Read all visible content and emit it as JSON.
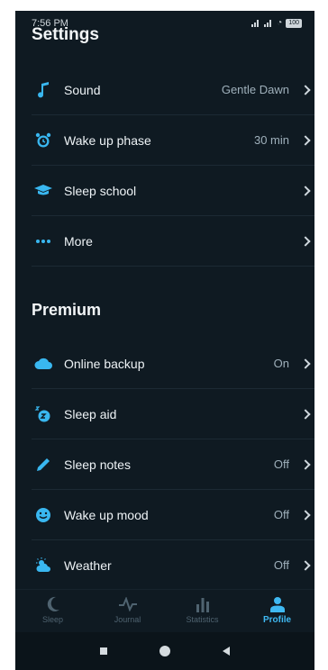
{
  "status_bar": {
    "time": "7:56 PM",
    "battery": "100"
  },
  "header": {
    "title": "Settings"
  },
  "settings": [
    {
      "icon": "music-note-icon",
      "label": "Sound",
      "value": "Gentle Dawn"
    },
    {
      "icon": "alarm-clock-icon",
      "label": "Wake up phase",
      "value": "30 min"
    },
    {
      "icon": "graduation-cap-icon",
      "label": "Sleep school",
      "value": ""
    },
    {
      "icon": "more-dots-icon",
      "label": "More",
      "value": ""
    }
  ],
  "premium": {
    "title": "Premium",
    "items": [
      {
        "icon": "cloud-icon",
        "label": "Online backup",
        "value": "On"
      },
      {
        "icon": "sleep-aid-icon",
        "label": "Sleep aid",
        "value": ""
      },
      {
        "icon": "pencil-icon",
        "label": "Sleep notes",
        "value": "Off"
      },
      {
        "icon": "smiley-icon",
        "label": "Wake up mood",
        "value": "Off"
      },
      {
        "icon": "weather-icon",
        "label": "Weather",
        "value": "Off"
      }
    ]
  },
  "bottom_nav": [
    {
      "icon": "moon-icon",
      "label": "Sleep",
      "active": false
    },
    {
      "icon": "pulse-icon",
      "label": "Journal",
      "active": false
    },
    {
      "icon": "bar-chart-icon",
      "label": "Statistics",
      "active": false
    },
    {
      "icon": "person-icon",
      "label": "Profile",
      "active": true
    }
  ],
  "colors": {
    "background": "#0f1a22",
    "accent": "#39b7f0",
    "inactive": "#4f6370"
  }
}
